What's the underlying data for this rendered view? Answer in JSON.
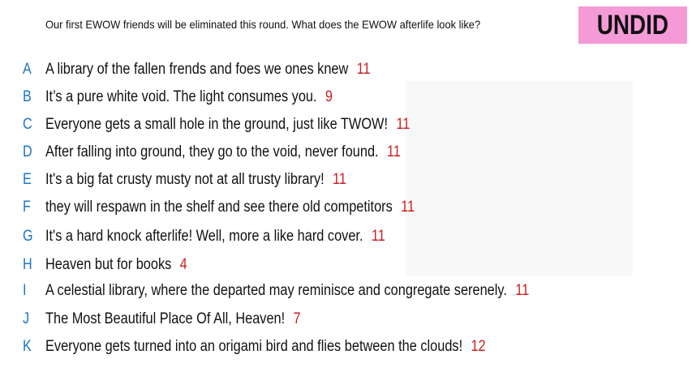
{
  "prompt": "Our first EWOW friends will be eliminated this round. What does the EWOW afterlife look like?",
  "badge": "UNDID",
  "colors": {
    "letter": "#1a73c8",
    "count": "#cc1f1f",
    "badge_bg": "#f49ad7"
  },
  "responses": [
    {
      "letter": "A",
      "text": "A library of the fallen frends and foes we ones knew",
      "count": "11"
    },
    {
      "letter": "B",
      "text": "It’s a pure white void. The light consumes you.",
      "count": "9"
    },
    {
      "letter": "C",
      "text": "Everyone gets a small hole in the ground, just like TWOW!",
      "count": "11"
    },
    {
      "letter": "D",
      "text": "After falling into ground, they go to the void, never found.",
      "count": "11"
    },
    {
      "letter": "E",
      "text": "It's a big fat crusty musty not at all trusty library!",
      "count": "11"
    },
    {
      "letter": "F",
      "text": "they will respawn in the shelf and see there old competitors",
      "count": "11"
    },
    {
      "letter": "G",
      "text": "It's a hard knock afterlife! Well, more a like hard cover.",
      "count": "11"
    },
    {
      "letter": "H",
      "text": "Heaven but for books",
      "count": "4"
    },
    {
      "letter": "I",
      "text": "A celestial library, where the departed may reminisce and congregate serenely.",
      "count": "11"
    },
    {
      "letter": "J",
      "text": "The Most Beautiful Place Of All, Heaven!",
      "count": "7"
    },
    {
      "letter": "K",
      "text": "Everyone gets turned into an origami bird and flies between the clouds!",
      "count": "12"
    }
  ]
}
